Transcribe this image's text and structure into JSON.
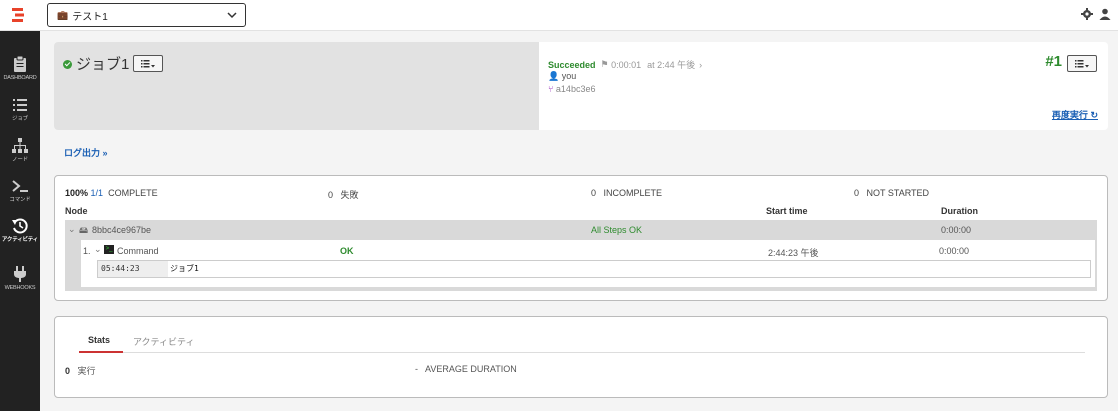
{
  "topbar": {
    "project": "テスト1",
    "icons": [
      "settings-icon",
      "user-icon"
    ]
  },
  "sidebar": {
    "items": [
      {
        "label": "DASHBOARD",
        "icon": "clipboard-icon"
      },
      {
        "label": "ジョブ",
        "icon": "job-list-icon"
      },
      {
        "label": "ノード",
        "icon": "node-tree-icon"
      },
      {
        "label": "コマンド",
        "icon": "terminal-icon"
      },
      {
        "label": "アクティビティ",
        "icon": "history-icon",
        "active": true
      },
      {
        "label": "WEBHOOKS",
        "icon": "plug-icon"
      }
    ]
  },
  "execution": {
    "job_name": "ジョブ1",
    "status": "Succeeded",
    "duration": "0:00:01",
    "time": "at 2:44 午後",
    "user": "you",
    "commit": "a14bc3e6",
    "run_number": "#1",
    "rerun_label": "再度実行",
    "log_link": "ログ出力 »"
  },
  "summary": {
    "percent": "100%",
    "fraction": "1/1",
    "complete_label": "COMPLETE",
    "failed_count": "0",
    "failed_label": "失敗",
    "incomplete_count": "0",
    "incomplete_label": "INCOMPLETE",
    "not_started_count": "0",
    "not_started_label": "NOT STARTED"
  },
  "columns": {
    "node": "Node",
    "start": "Start time",
    "duration": "Duration"
  },
  "node": {
    "name": "8bbc4ce967be",
    "status": "All Steps OK",
    "duration": "0:00:00"
  },
  "step": {
    "index": "1.",
    "name": "Command",
    "status": "OK",
    "start": "2:44:23 午後",
    "duration": "0:00:00"
  },
  "log": {
    "time": "05:44:23",
    "message": "ジョブ1"
  },
  "stats": {
    "tabs": [
      "Stats",
      "アクティビティ"
    ],
    "exec_count": "0",
    "exec_label": "実行",
    "avg_value": "-",
    "avg_label": "AVERAGE DURATION"
  },
  "colors": {
    "success": "#2e8b2e",
    "link": "#1a5fb4",
    "sidebar_bg": "#222222",
    "tab_accent": "#cc3333"
  }
}
